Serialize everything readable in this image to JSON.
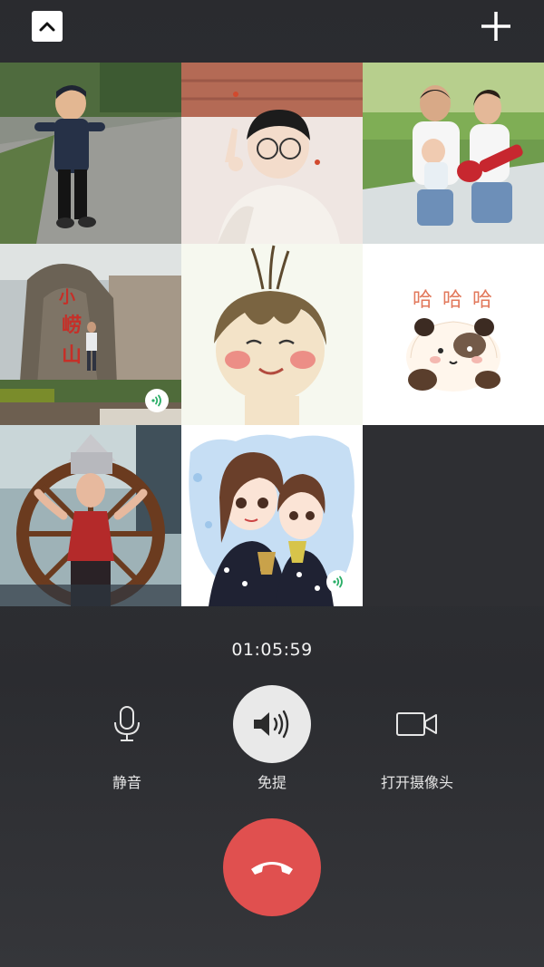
{
  "call": {
    "duration": "01:05:59",
    "participant_count": 8
  },
  "controls": {
    "mute_label": "静音",
    "speaker_label": "免提",
    "camera_label": "打开摄像头"
  },
  "participants": [
    {
      "icon": "child-photo",
      "speaking": false
    },
    {
      "icon": "boy-glasses-photo",
      "speaking": false
    },
    {
      "icon": "family-photo",
      "speaking": false
    },
    {
      "icon": "landmark-photo",
      "speaking": true
    },
    {
      "icon": "cartoon-girl-avatar",
      "speaking": false
    },
    {
      "icon": "panda-sticker-avatar",
      "speaking": false,
      "sticker_text": "哈 哈 哈"
    },
    {
      "icon": "dancer-photo",
      "speaking": false
    },
    {
      "icon": "cartoon-couple-avatar",
      "speaking": true
    }
  ],
  "colors": {
    "background": "#2b2c30",
    "hangup": "#e0504f",
    "speaking_indicator": "#2aae67",
    "active_control": "#e9e9e9"
  }
}
